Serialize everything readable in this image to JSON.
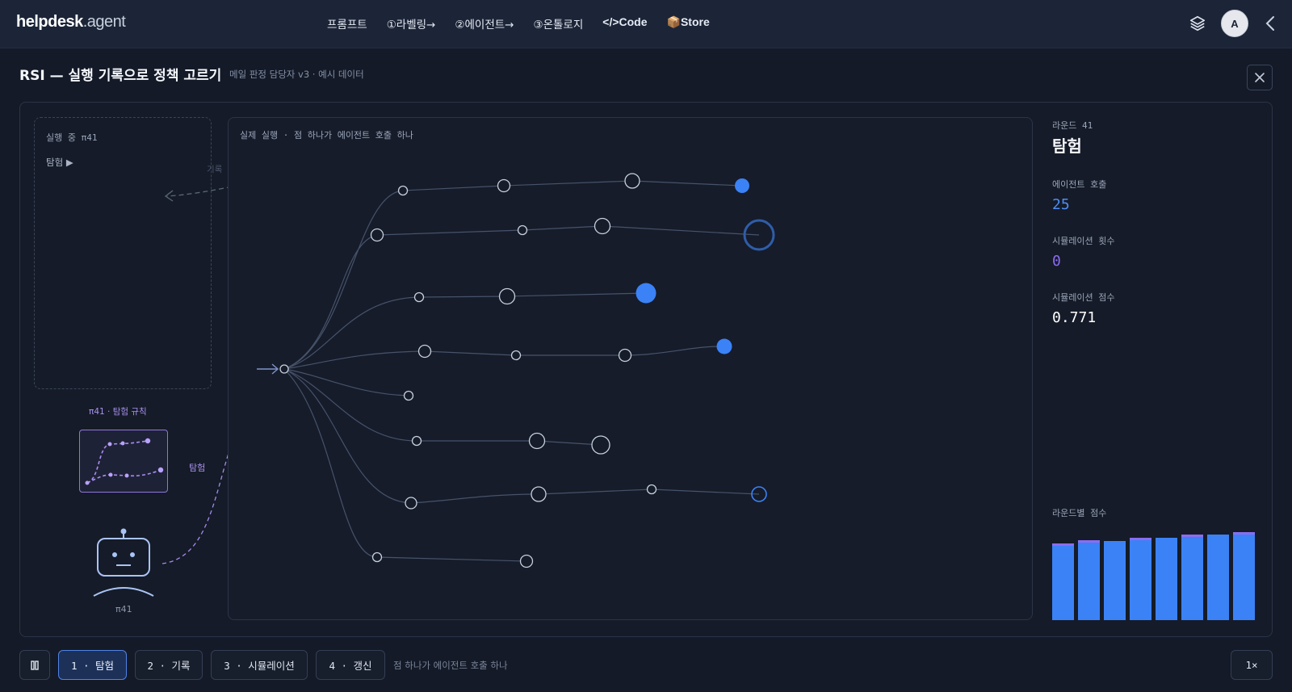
{
  "app": {
    "logo_main": "helpdesk",
    "logo_sub": ".agent"
  },
  "nav": {
    "items": [
      {
        "label": "프롬프트"
      },
      {
        "label": "①라벨링→"
      },
      {
        "label": "②에이전트→"
      },
      {
        "label": "③온톨로지"
      },
      {
        "label": "</>Code"
      },
      {
        "label": "📦Store"
      }
    ]
  },
  "header": {
    "avatar_initial": "A",
    "icons": [
      "layers-icon",
      "avatar",
      "chevron-left-icon"
    ]
  },
  "page": {
    "title": "RSI — 실행 기록으로 정책 고르기",
    "subtitle": "메일 판정 담당자 v3 · 예시 데이터"
  },
  "left": {
    "exec_label": "실행 중 π41",
    "exec_mode": "탐험 ▶",
    "record_label": "기록",
    "policy_label": "π41 · 탐험 규칙",
    "side_label": "탐험",
    "robot_label": "π41"
  },
  "runs": {
    "label": "실제 실행 · 점 하나가 에이전트 호출 하나"
  },
  "stats": {
    "round_label": "라운드 41",
    "round_mode": "탐험",
    "agent_calls_label": "에이전트 호출",
    "agent_calls": "25",
    "sim_count_label": "시뮬레이션 횟수",
    "sim_count": "0",
    "sim_score_label": "시뮬레이션 점수",
    "sim_score": "0.771",
    "bars_label": "라운드별 점수",
    "colors": {
      "bar": "#3b82f6",
      "bar_top": "#8b6cf0",
      "calls": "#4f8df5",
      "sim": "#8b6cf0"
    }
  },
  "bottom": {
    "pause_icon": "pause-icon",
    "steps": [
      {
        "label": "1 · 탐험",
        "active": true
      },
      {
        "label": "2 · 기록",
        "active": false
      },
      {
        "label": "3 · 시뮬레이션",
        "active": false
      },
      {
        "label": "4 · 갱신",
        "active": false
      }
    ],
    "hint": "점 하나가 에이전트 호출 하나",
    "speed": "1×"
  }
}
